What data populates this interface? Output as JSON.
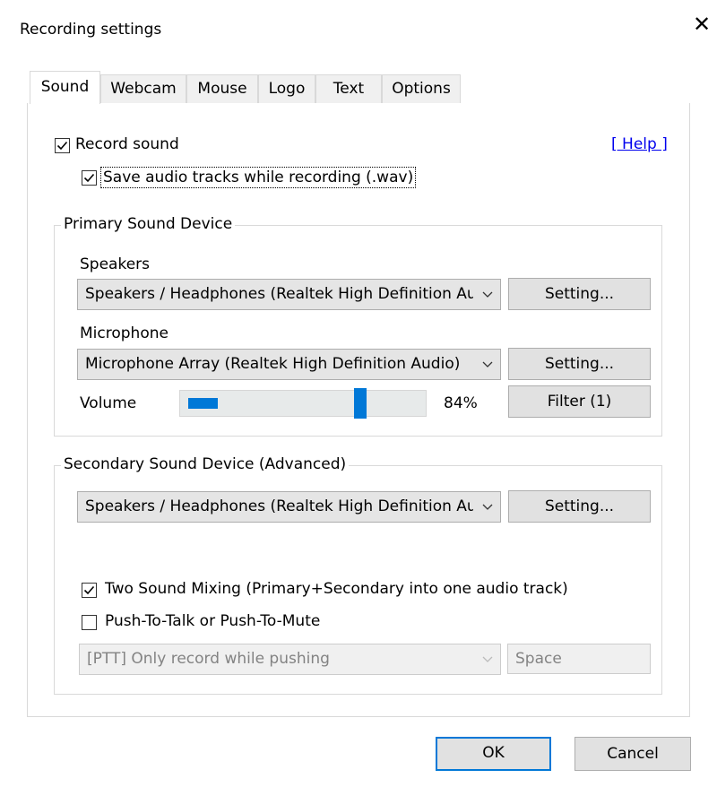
{
  "window": {
    "title": "Recording settings",
    "close_glyph": "✕"
  },
  "tabs": [
    {
      "label": "Sound",
      "active": true
    },
    {
      "label": "Webcam",
      "active": false
    },
    {
      "label": "Mouse",
      "active": false
    },
    {
      "label": "Logo",
      "active": false
    },
    {
      "label": "Text",
      "active": false
    },
    {
      "label": "Options",
      "active": false
    }
  ],
  "sound": {
    "record_sound": {
      "label": "Record sound",
      "checked": true
    },
    "help_link": "[ Help ]",
    "save_tracks": {
      "label": "Save audio tracks while recording (.wav)",
      "checked": true
    },
    "primary": {
      "title": "Primary Sound Device",
      "speakers_label": "Speakers",
      "speakers_value": "Speakers / Headphones (Realtek High Definition Audio)",
      "speakers_setting": "Setting...",
      "microphone_label": "Microphone",
      "microphone_value": "Microphone Array (Realtek High Definition Audio)",
      "microphone_setting": "Setting...",
      "volume_label": "Volume",
      "volume_value": "84%",
      "volume_level": 0.84,
      "filter_button": "Filter (1)"
    },
    "secondary": {
      "title": "Secondary Sound Device (Advanced)",
      "device_value": "Speakers / Headphones (Realtek High Definition Audio)",
      "device_setting": "Setting...",
      "two_sound_mixing": {
        "label": "Two Sound Mixing (Primary+Secondary into one audio track)",
        "checked": true
      },
      "push_to_talk": {
        "label": "Push-To-Talk or Push-To-Mute",
        "checked": false
      },
      "ptt_mode_value": "[PTT] Only record while pushing",
      "ptt_key_value": "Space"
    }
  },
  "footer": {
    "ok": "OK",
    "cancel": "Cancel"
  },
  "colors": {
    "accent": "#0078d7",
    "link": "#0000ee"
  }
}
